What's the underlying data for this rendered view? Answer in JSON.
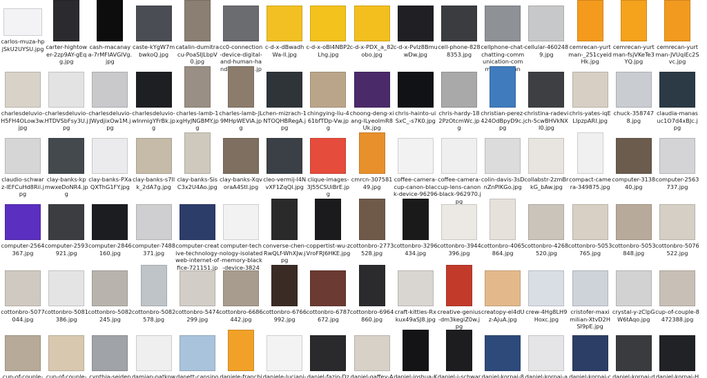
{
  "files": [
    {
      "name": "carlos-muza-hpjSkU2UYSU.jpg",
      "color": "#f3f3f6",
      "kind": "wide"
    },
    {
      "name": "carter-hightower-2zp9AY-gEqg.jpg",
      "color": "#2b2b2f",
      "kind": "tall"
    },
    {
      "name": "cash-macanaya-7rMFIAVGlVg.jpg",
      "color": "#0d0d0d",
      "kind": "tall"
    },
    {
      "name": "caste-kYgW7mbwkoQ.jpg",
      "color": "#4a4e54",
      "kind": "square"
    },
    {
      "name": "catalin-dumitracu-PoaSIJLbpV0.jpg",
      "color": "#8a7f72",
      "kind": "tall"
    },
    {
      "name": "cc0-connection-device-digital-and-human-hand-1458003.jpg",
      "color": "#6a6c70",
      "kind": "square"
    },
    {
      "name": "c-d-x-dBwadhWa-ll.jpg",
      "color": "#f2c022",
      "kind": "square"
    },
    {
      "name": "c-d-x-oBI4NBP2Lhg.jpg",
      "color": "#f4c21c",
      "kind": "square"
    },
    {
      "name": "c-d-x-PDX_a_82obo.jpg",
      "color": "#f3bf1f",
      "kind": "square"
    },
    {
      "name": "c-d-x-PvIz8BmuwDw.jpg",
      "color": "#202024",
      "kind": "square"
    },
    {
      "name": "cell-phone-8288353.jpg",
      "color": "#3a3c40",
      "kind": "square"
    },
    {
      "name": "cellphone-chat-chatting-communication-community-conne...",
      "color": "#8e9196",
      "kind": "square"
    },
    {
      "name": "cellular-4602489.jpg",
      "color": "#c7c8ca",
      "kind": "square"
    },
    {
      "name": "cemrecan-yurtman-_251cyeidHk.jpg",
      "color": "#f49b1e",
      "kind": "tall"
    },
    {
      "name": "cemrecan-yurtman-fsjVKeTe3YQ.jpg",
      "color": "#f5a21c",
      "kind": "tall"
    },
    {
      "name": "cemrecan-yurtman-JVUqiEc2Svc.jpg",
      "color": "#f29a1f",
      "kind": "tall"
    },
    {
      "name": "charlesdeluvio-H5FH4OLow3w.jpg",
      "color": "#d9d2c8",
      "kind": "square"
    },
    {
      "name": "charlesdeluvio-HTDVSbFsy3U.jpg",
      "color": "#e3e3e3",
      "kind": "square"
    },
    {
      "name": "charlesdeluvio-JWydjixOw1M.jpg",
      "color": "#c9c9cb",
      "kind": "square"
    },
    {
      "name": "charlesdeluvio-wInmigYFrBk.jpg",
      "color": "#1e1f22",
      "kind": "square"
    },
    {
      "name": "charles-lamb-1xgHyJNGBMY.jpg",
      "color": "#9a8f84",
      "kind": "tall"
    },
    {
      "name": "charles-lamb-JL9MHpWEViA.jpg",
      "color": "#8c7c6c",
      "kind": "tall"
    },
    {
      "name": "chen-mizrach-1NTOQHBRegA.jpg",
      "color": "#2f3439",
      "kind": "square"
    },
    {
      "name": "chingying-liu-461bfTDp-Vw.jpg",
      "color": "#bba58a",
      "kind": "square"
    },
    {
      "name": "choong-deng-xiang-lLyeoImR8Uk.jpg",
      "color": "#4b2a6a",
      "kind": "square"
    },
    {
      "name": "chris-hainto-uiSxC_-s7K0.jpg",
      "color": "#101215",
      "kind": "square"
    },
    {
      "name": "chris-hardy-182PzOtcmWc.jpg",
      "color": "#a9a9a9",
      "kind": "square"
    },
    {
      "name": "christian-perez-424OdBpyD9c.jpg",
      "color": "#3f7bbd",
      "kind": "tall"
    },
    {
      "name": "christina-radevich-5cwBHVkNXI0.jpg",
      "color": "#3d3f43",
      "kind": "square"
    },
    {
      "name": "chris-yates-iqELIpzpARI.jpg",
      "color": "#d8cfc4",
      "kind": "square"
    },
    {
      "name": "chuck-3587478.jpg",
      "color": "#c9ccd1",
      "kind": "square"
    },
    {
      "name": "claudia-manasuc1O7d4xBJc.jpg",
      "color": "#2c3a45",
      "kind": "square"
    },
    {
      "name": "claudio-schwarz-lEFCuHd8Rii.jpg",
      "color": "#d6d6d6",
      "kind": "square"
    },
    {
      "name": "clay-banks-kpmwxeDoNR4.jpg",
      "color": "#44494e",
      "kind": "square"
    },
    {
      "name": "clay-banks-PXaQXThG1FY.jpg",
      "color": "#ebebed",
      "kind": "square"
    },
    {
      "name": "clay-banks-s7IIk_2dA7g.jpg",
      "color": "#c5bba8",
      "kind": "square"
    },
    {
      "name": "clay-banks-SisC3x2U4Ao.jpg",
      "color": "#cfc8bc",
      "kind": "tall"
    },
    {
      "name": "clay-banks-XqvoraA4StI.jpg",
      "color": "#7e6f60",
      "kind": "square"
    },
    {
      "name": "cleo-vermij-l4NvXF1ZqQI.jpg",
      "color": "#3a4046",
      "kind": "square"
    },
    {
      "name": "clique-images-3J55CSUiBrE.jpg",
      "color": "#e64c3c",
      "kind": "square"
    },
    {
      "name": "cmrcn-30758149.jpg",
      "color": "#e8902b",
      "kind": "tall"
    },
    {
      "name": "coffee-camera-cup-canon-black-device-962967.jpg",
      "color": "#f2f2f2",
      "kind": "square"
    },
    {
      "name": "coffee-camera-cup-lens-canon-black-962970.jpg",
      "color": "#efefef",
      "kind": "square"
    },
    {
      "name": "colin-davis-3sDnZnPlKGo.jpg",
      "color": "#dcdcdc",
      "kind": "square"
    },
    {
      "name": "collabstr-2zmBrkG_bAw.jpg",
      "color": "#e8e4df",
      "kind": "square"
    },
    {
      "name": "compact-camera-349875.jpg",
      "color": "#f0f0f0",
      "kind": "tall"
    },
    {
      "name": "computer-313840.jpg",
      "color": "#6b5c4e",
      "kind": "square"
    },
    {
      "name": "computer-2563737.jpg",
      "color": "#d4d4d6",
      "kind": "square"
    },
    {
      "name": "computer-2564367.jpg",
      "color": "#5b2fbf",
      "kind": "square"
    },
    {
      "name": "computer-2593921.jpg",
      "color": "#3b3d40",
      "kind": "square"
    },
    {
      "name": "computer-2846160.jpg",
      "color": "#1c1d20",
      "kind": "square"
    },
    {
      "name": "computer-7488371.jpg",
      "color": "#cfcfd1",
      "kind": "square"
    },
    {
      "name": "computer-creative-technology-web-internet-office-721151.jpg",
      "color": "#2d3d6a",
      "kind": "square"
    },
    {
      "name": "computer-technology-isolated-memory-black-device-38243...",
      "color": "#f2f2f2",
      "kind": "square"
    },
    {
      "name": "converse-chen-RwQLf-WhXJw.jpg",
      "color": "#2a2a2a",
      "kind": "tall"
    },
    {
      "name": "coppertist-wu-zVroFRJ6HKE.jpg",
      "color": "#1b1b1d",
      "kind": "tall"
    },
    {
      "name": "cottonbro-2773528.jpg",
      "color": "#6f5a4a",
      "kind": "tall"
    },
    {
      "name": "cottonbro-3296434.jpg",
      "color": "#1a1a1a",
      "kind": "tall"
    },
    {
      "name": "cottonbro-3944396.jpg",
      "color": "#ece9e4",
      "kind": "square"
    },
    {
      "name": "cottonbro-4065864.jpg",
      "color": "#e6e1da",
      "kind": "tall"
    },
    {
      "name": "cottonbro-4268520.jpg",
      "color": "#cac4bb",
      "kind": "square"
    },
    {
      "name": "cottonbro-5053765.jpg",
      "color": "#d8d0c4",
      "kind": "square"
    },
    {
      "name": "cottonbro-5053848.jpg",
      "color": "#b8aa9a",
      "kind": "square"
    },
    {
      "name": "cottonbro-5076522.jpg",
      "color": "#d6cfc5",
      "kind": "square"
    },
    {
      "name": "cottonbro-5077044.jpg",
      "color": "#cfc9c1",
      "kind": "square"
    },
    {
      "name": "cottonbro-5081386.jpg",
      "color": "#e4e4e4",
      "kind": "square"
    },
    {
      "name": "cottonbro-5082245.jpg",
      "color": "#b9b3ad",
      "kind": "square"
    },
    {
      "name": "cottonbro-5082578.jpg",
      "color": "#bfc4c9",
      "kind": "tall"
    },
    {
      "name": "cottonbro-5474299.jpg",
      "color": "#d2cdc6",
      "kind": "square"
    },
    {
      "name": "cottonbro-6686442.jpg",
      "color": "#a89c8f",
      "kind": "square"
    },
    {
      "name": "cottonbro-6766992.jpg",
      "color": "#3a2c25",
      "kind": "tall"
    },
    {
      "name": "cottonbro-6787672.jpg",
      "color": "#6b3a32",
      "kind": "square"
    },
    {
      "name": "cottonbro-6964860.jpg",
      "color": "#2b2b2e",
      "kind": "tall"
    },
    {
      "name": "craft-kitties-Rxkux49aSJ8.jpg",
      "color": "#d9d6d2",
      "kind": "square"
    },
    {
      "name": "creative-genius-dm3kegiZ0w.jpg",
      "color": "#c23a2a",
      "kind": "tall"
    },
    {
      "name": "creatopy-el4dUz-AjuA.jpg",
      "color": "#e3b98c",
      "kind": "square"
    },
    {
      "name": "crew-4Hg8LH9Hoxc.jpg",
      "color": "#d8dee4",
      "kind": "square"
    },
    {
      "name": "cristofer-maximilian-XtvD2HSI9pE.jpg",
      "color": "#cdd3d9",
      "kind": "square"
    },
    {
      "name": "crystal-y-zClpGW6tAqo.jpg",
      "color": "#d2d2d2",
      "kind": "square"
    },
    {
      "name": "cup-of-couple-8472388.jpg",
      "color": "#c8c0b6",
      "kind": "square"
    },
    {
      "name": "cup-of-couple-",
      "color": "#b7aa98",
      "kind": "square"
    },
    {
      "name": "cup-of-couple-",
      "color": "#d8c8b0",
      "kind": "square"
    },
    {
      "name": "cynthia-seidens",
      "color": "#a0a3a8",
      "kind": "square"
    },
    {
      "name": "damian-patkow",
      "color": "#efefef",
      "kind": "square"
    },
    {
      "name": "danett-cansino-",
      "color": "#a9c3dc",
      "kind": "square"
    },
    {
      "name": "daniele-franchi-",
      "color": "#f1a128",
      "kind": "tall"
    },
    {
      "name": "daniele-luciani-",
      "color": "#f3f3f3",
      "kind": "square"
    },
    {
      "name": "daniel-fazio-Dz",
      "color": "#2a2a2c",
      "kind": "square"
    },
    {
      "name": "daniel-gaffey-A",
      "color": "#d8d1c8",
      "kind": "square"
    },
    {
      "name": "daniel-joshua-K",
      "color": "#141416",
      "kind": "tall"
    },
    {
      "name": "daniel-j-schwar",
      "color": "#1d1d1f",
      "kind": "tall"
    },
    {
      "name": "daniel-korpai-8",
      "color": "#2d4a7a",
      "kind": "square"
    },
    {
      "name": "daniel-korpai-a",
      "color": "#e5e5e7",
      "kind": "square"
    },
    {
      "name": "daniel-korpai-c",
      "color": "#2c3e66",
      "kind": "square"
    },
    {
      "name": "daniel-korpai-d",
      "color": "#3a3b3f",
      "kind": "square"
    },
    {
      "name": "daniel-korpai-H",
      "color": "#202226",
      "kind": "square"
    }
  ]
}
